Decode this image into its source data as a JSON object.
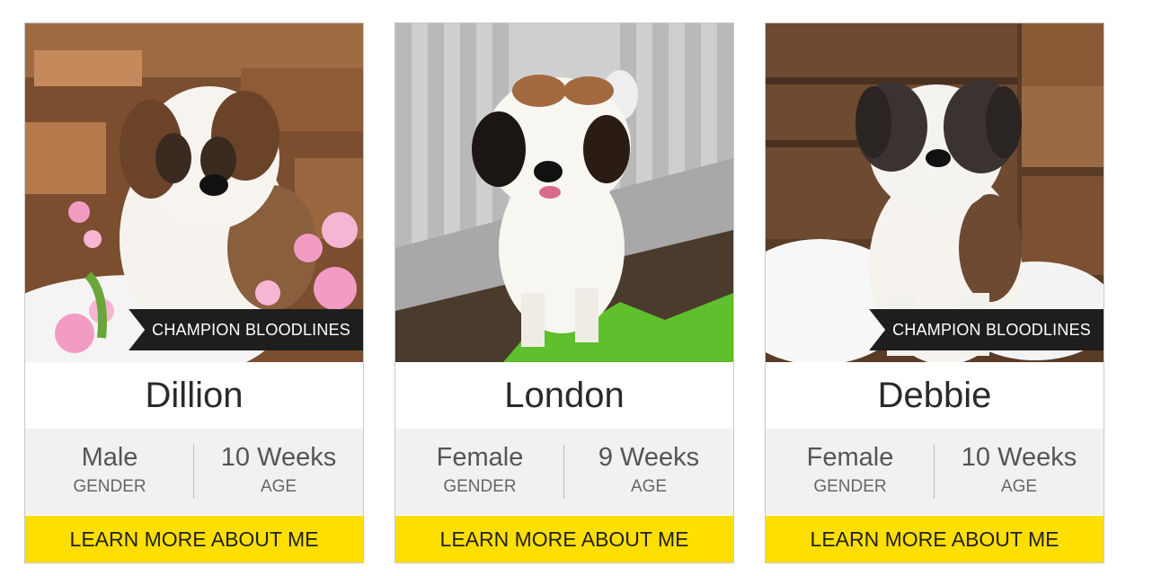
{
  "colors": {
    "cta": "#ffdf00",
    "badge": "#1e1e1e",
    "meta_bg": "#f1f1f1"
  },
  "puppies": [
    {
      "name": "Dillion",
      "badge": "CHAMPION BLOODLINES",
      "gender_value": "Male",
      "gender_label": "GENDER",
      "age_value": "10 Weeks",
      "age_label": "AGE",
      "cta": "LEARN MORE ABOUT ME"
    },
    {
      "name": "London",
      "gender_value": "Female",
      "gender_label": "GENDER",
      "age_value": "9 Weeks",
      "age_label": "AGE",
      "cta": "LEARN MORE ABOUT ME"
    },
    {
      "name": "Debbie",
      "badge": "CHAMPION BLOODLINES",
      "gender_value": "Female",
      "gender_label": "GENDER",
      "age_value": "10 Weeks",
      "age_label": "AGE",
      "cta": "LEARN MORE ABOUT ME"
    }
  ]
}
